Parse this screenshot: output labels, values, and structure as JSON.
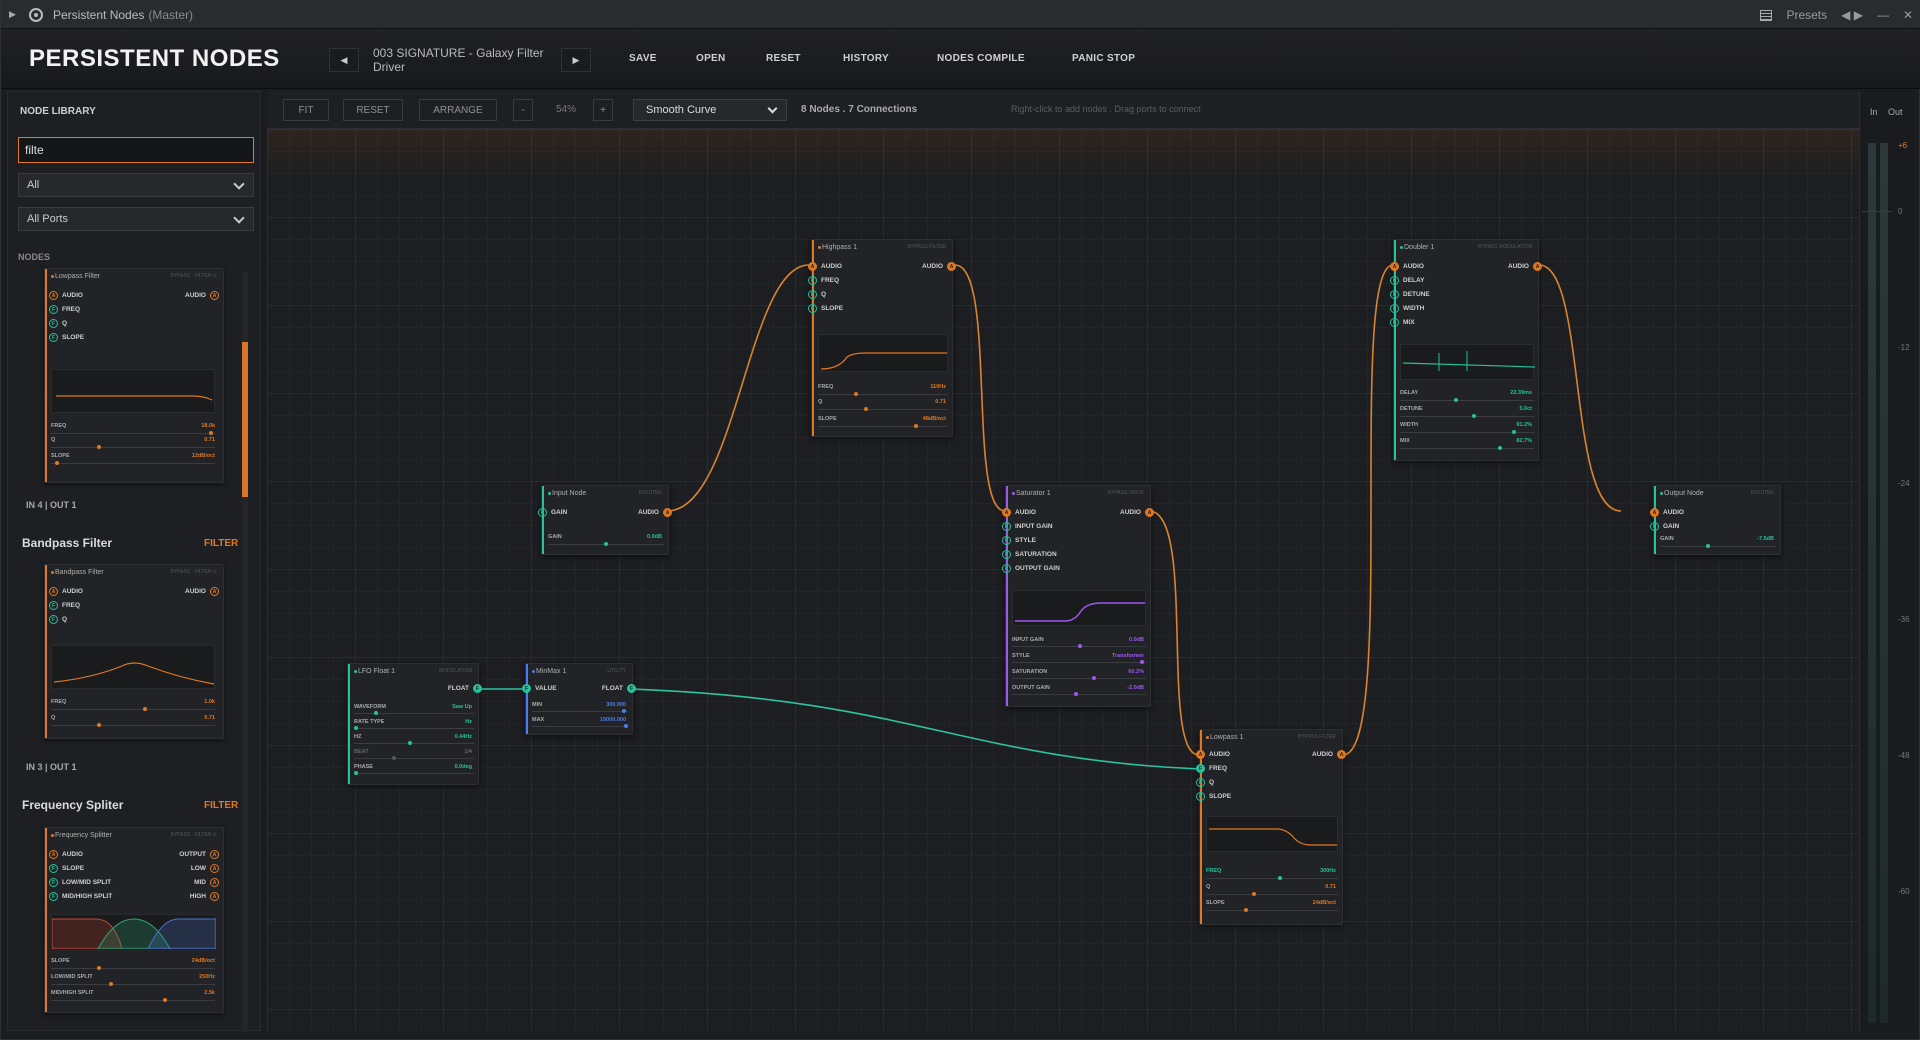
{
  "window": {
    "title": "Persistent Nodes",
    "subtitle": "(Master)",
    "presets_label": "Presets"
  },
  "header": {
    "brand": "PERSISTENT NODES",
    "preset_name": "003 SIGNATURE - Galaxy Filter Driver",
    "buttons": [
      "SAVE",
      "OPEN",
      "RESET",
      "HISTORY",
      "NODES COMPILE",
      "PANIC STOP"
    ]
  },
  "library": {
    "title": "NODE LIBRARY",
    "search_value": "filte",
    "category": "All",
    "ports": "All Ports",
    "section_label": "NODES",
    "entries": [
      {
        "io": "IN 4  |  OUT 1"
      },
      {
        "title": "Bandpass Filter",
        "tag": "FILTER",
        "io": "IN 3  |  OUT 1"
      },
      {
        "title": "Frequency Spliter",
        "tag": "FILTER"
      }
    ],
    "card_lowpass": {
      "title": "Lowpass Filter",
      "ports": [
        "AUDIO",
        "FREQ",
        "Q",
        "SLOPE"
      ],
      "out": "AUDIO",
      "params": [
        {
          "name": "FREQ",
          "value": "18.0k"
        },
        {
          "name": "Q",
          "value": "0.71"
        },
        {
          "name": "SLOPE",
          "value": "12dB/oct"
        }
      ]
    },
    "card_bandpass": {
      "title": "Bandpass Filter",
      "ports": [
        "AUDIO",
        "FREQ",
        "Q"
      ],
      "out": "AUDIO",
      "params": [
        {
          "name": "FREQ",
          "value": "1.0k"
        },
        {
          "name": "Q",
          "value": "0.71"
        }
      ]
    },
    "card_split": {
      "title": "Frequency Splitter",
      "ports": [
        "AUDIO",
        "SLOPE",
        "LOW/MID SPLIT",
        "MID/HIGH SPLIT"
      ],
      "outs": [
        "OUTPUT",
        "LOW",
        "MID",
        "HIGH"
      ],
      "params": [
        {
          "name": "SLOPE",
          "value": "24dB/oct"
        },
        {
          "name": "LOW/MID SPLIT",
          "value": "250Hz"
        },
        {
          "name": "MID/HIGH SPLIT",
          "value": "2.5k"
        }
      ]
    }
  },
  "toolbar": {
    "fit": "FIT",
    "reset": "RESET",
    "arrange": "ARRANGE",
    "zoom_out": "-",
    "zoom": "54%",
    "zoom_in": "+",
    "curve": "Smooth Curve",
    "stats": "8 Nodes  .  7 Connections",
    "hint": "Right-click to add nodes  .  Drag ports to connect"
  },
  "nodes": {
    "highpass": {
      "title": "Highpass 1",
      "tags": "BYPASS  FILTER",
      "ports": [
        "AUDIO",
        "FREQ",
        "Q",
        "SLOPE"
      ],
      "out": "AUDIO",
      "params": [
        {
          "name": "FREQ",
          "value": "110Hz"
        },
        {
          "name": "Q",
          "value": "0.71"
        },
        {
          "name": "SLOPE",
          "value": "48dB/oct"
        }
      ]
    },
    "input": {
      "title": "Input Node",
      "tags": "ROUTING",
      "ports": [
        "GAIN"
      ],
      "out": "AUDIO",
      "params": [
        {
          "name": "GAIN",
          "value": "0.0dB"
        }
      ]
    },
    "saturator": {
      "title": "Saturator 1",
      "tags": "BYPASS  DRIVE",
      "ports": [
        "AUDIO",
        "INPUT GAIN",
        "STYLE",
        "SATURATION",
        "OUTPUT GAIN"
      ],
      "out": "AUDIO",
      "params": [
        {
          "name": "INPUT GAIN",
          "value": "0.0dB"
        },
        {
          "name": "STYLE",
          "value": "Transformer"
        },
        {
          "name": "SATURATION",
          "value": "60.2%"
        },
        {
          "name": "OUTPUT GAIN",
          "value": "-2.0dB"
        }
      ]
    },
    "doubler": {
      "title": "Doubler 1",
      "tags": "BYPASS  MODULATION",
      "ports": [
        "AUDIO",
        "DELAY",
        "DETUNE",
        "WIDTH",
        "MIX"
      ],
      "out": "AUDIO",
      "params": [
        {
          "name": "DELAY",
          "value": "22.39ms"
        },
        {
          "name": "DETUNE",
          "value": "5.0ct"
        },
        {
          "name": "WIDTH",
          "value": "91.2%"
        },
        {
          "name": "MIX",
          "value": "82.7%"
        }
      ]
    },
    "output": {
      "title": "Output Node",
      "tags": "ROUTING",
      "ports": [
        "AUDIO",
        "GAIN"
      ],
      "params": [
        {
          "name": "GAIN",
          "value": "-7.5dB"
        }
      ]
    },
    "lfo": {
      "title": "LFO Float 1",
      "tags": "MODULATION",
      "out": "FLOAT",
      "params": [
        {
          "name": "WAVEFORM",
          "value": "Saw Up"
        },
        {
          "name": "RATE TYPE",
          "value": "Hz"
        },
        {
          "name": "HZ",
          "value": "0.44Hz"
        },
        {
          "name": "BEAT",
          "value": "1/4"
        },
        {
          "name": "PHASE",
          "value": "0.0deg"
        }
      ]
    },
    "minmax": {
      "title": "MinMax 1",
      "tags": "UTILITY",
      "ports": [
        "VALUE"
      ],
      "out": "FLOAT",
      "params": [
        {
          "name": "MIN",
          "value": "300.000"
        },
        {
          "name": "MAX",
          "value": "15000.000"
        }
      ]
    },
    "lowpass": {
      "title": "Lowpass 1",
      "tags": "BYPASS  FILTER",
      "ports": [
        "AUDIO",
        "FREQ",
        "Q",
        "SLOPE"
      ],
      "out": "AUDIO",
      "params": [
        {
          "name": "FREQ",
          "value": "300Hz"
        },
        {
          "name": "Q",
          "value": "0.71"
        },
        {
          "name": "SLOPE",
          "value": "24dB/oct"
        }
      ]
    }
  },
  "meter": {
    "in": "In",
    "out": "Out",
    "ticks": [
      "+6",
      "0",
      "-12",
      "-24",
      "-36",
      "-48",
      "-60"
    ]
  },
  "colors": {
    "audio": "#e07820",
    "float": "#24c29a",
    "drive": "#9b59f0",
    "minmax": "#4a7cf5",
    "accent": "#e07820"
  }
}
